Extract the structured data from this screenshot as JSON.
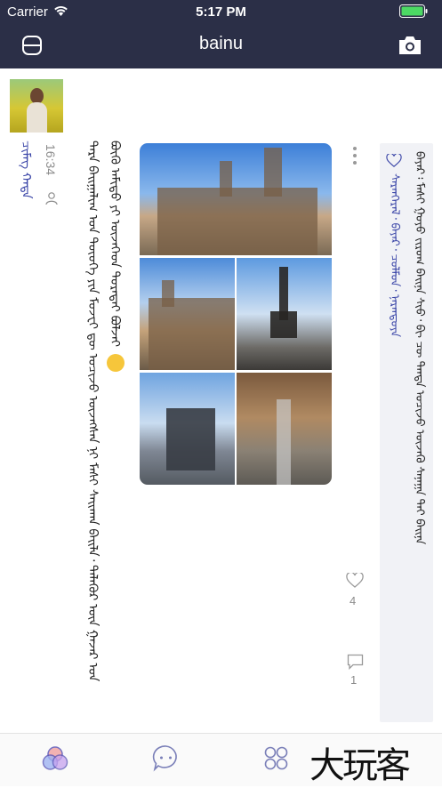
{
  "status": {
    "carrier": "Carrier",
    "time": "5:17 PM"
  },
  "nav": {
    "title": "bainu",
    "left_icon": "menu-icon",
    "right_icon": "camera-icon"
  },
  "post": {
    "author": "ᠴᠢᠮᠡᠭ ᠬᠠᠳᠠ",
    "time": "16:34",
    "text": "ᠲᠡᠷᠡ ᠪᠠᠢᠭᠠᠯᠢᠭ ᠤᠨ ᠲᠦᠦᠬᠡ ᠶᠢᠨ ᠮᠤᠵᠧᠢ ᠳᠦ ᠣᠴᠢᠵᠤ ᠦᠵᠡᠭᠰᠡᠨ ᠨᠢ ᠮᠠᠰᠢ ᠰᠠᠢᠬᠠᠨ ᠪᠠᠢᠯᠠ᠂ ᠲᠡᠯᠡᠭᠦᠷ ᠦᠨ ᠭᠠᠵᠠᠷ ᠤᠨ ᠪᠦᠬᠦ ᠠᠮᠢᠳᠤ ᠶᠢ ᠦᠵᠡᠭᠡᠳ ᠳᠤᠷᠠᠲᠠᠢ ᠪᠤᠯᠵᠠᠢ",
    "likes": "4",
    "comments": "1",
    "liked_by": "ᠰᠠᠷᠠᠨᠭᠡᠷᠡᠯ᠂ ᠪᠠᠶᠠᠷ᠂ ᠴᠣᠯᠮᠣᠨ᠂ ᠨᠠᠷᠠᠨᠲᠤᠶᠠ",
    "comment": "ᠪᠠᠶᠠᠷ᠄ ᠮᠠᠰᠢ ᠭᠣᠶᠣ ᠵᠢᠷᠤᠭ ᠪᠠᠢᠨᠠ ᠰᠢᠦ᠂ ᠪᠢ ᠴᠦ ᠲᠡᠨᠳᠡ ᠣᠴᠢᠵᠤ ᠦᠵᠡᠬᠦ ᠰᠠᠨᠠᠭᠠ ᠲᠠᠢ ᠪᠠᠢᠨᠠ"
  },
  "tabs": [
    "home-circles-icon",
    "chat-bubble-icon",
    "apps-grid-icon"
  ],
  "watermark": "大玩客"
}
